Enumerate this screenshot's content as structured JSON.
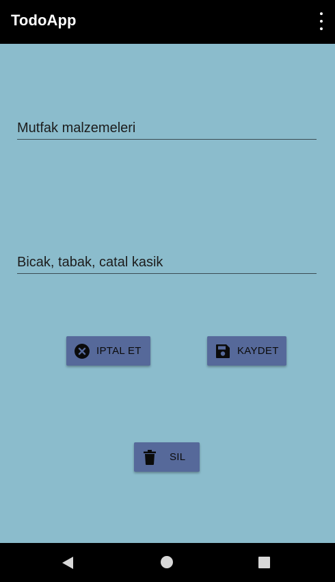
{
  "app_bar": {
    "title": "TodoApp",
    "overflow_icon": "more-vert-icon"
  },
  "form": {
    "title_field": {
      "value": "Mutfak malzemeleri"
    },
    "detail_field": {
      "value": "Bicak, tabak, catal kasik"
    }
  },
  "buttons": {
    "cancel": {
      "label": "IPTAL ET",
      "icon": "cancel-circle-icon"
    },
    "save": {
      "label": "KAYDET",
      "icon": "floppy-disk-icon"
    },
    "delete": {
      "label": "SIL",
      "icon": "trash-icon"
    }
  },
  "nav_bar": {
    "back_icon": "back-triangle-icon",
    "home_icon": "home-circle-icon",
    "recents_icon": "recents-square-icon"
  },
  "colors": {
    "background": "#8bbccc",
    "app_bar": "#000000",
    "button": "#56699a"
  }
}
